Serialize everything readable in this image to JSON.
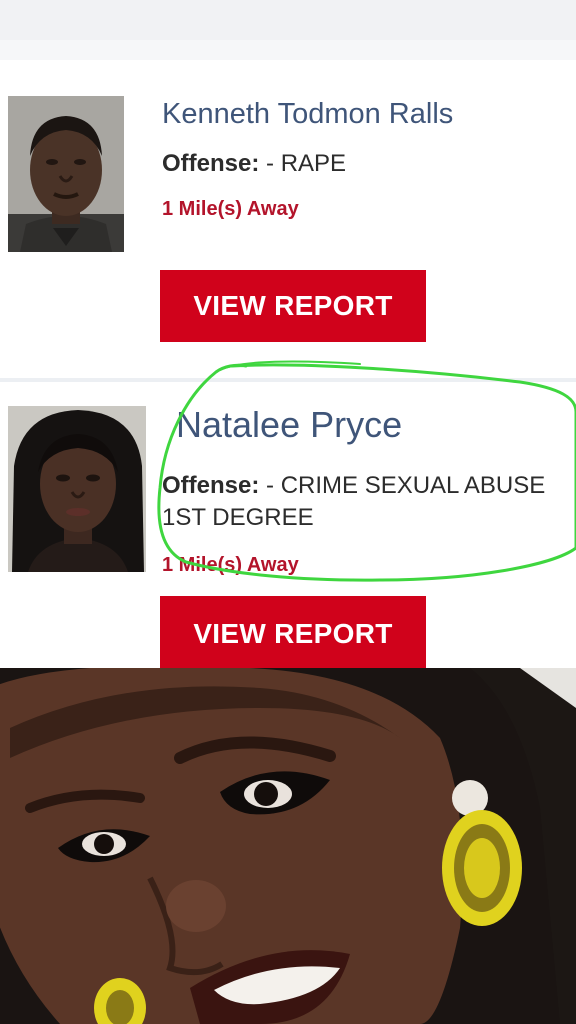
{
  "listings": [
    {
      "name": "Kenneth Todmon Ralls",
      "offense_label": "Offense:",
      "offense_value": " - RAPE",
      "distance": "1 Mile(s) Away",
      "button_label": "VIEW REPORT"
    },
    {
      "name": "Natalee Pryce",
      "offense_label": "Offense:",
      "offense_value": " - CRIME SEXUAL ABUSE 1ST DEGREE",
      "distance": "1 Mile(s) Away",
      "button_label": "VIEW REPORT"
    }
  ],
  "colors": {
    "name": "#3f5579",
    "distance": "#b3142b",
    "button": "#d0021b",
    "annotation": "#3fd63f"
  },
  "annotation": {
    "type": "hand-drawn-circle",
    "color": "#3fd63f",
    "target": "listing-2-details"
  }
}
